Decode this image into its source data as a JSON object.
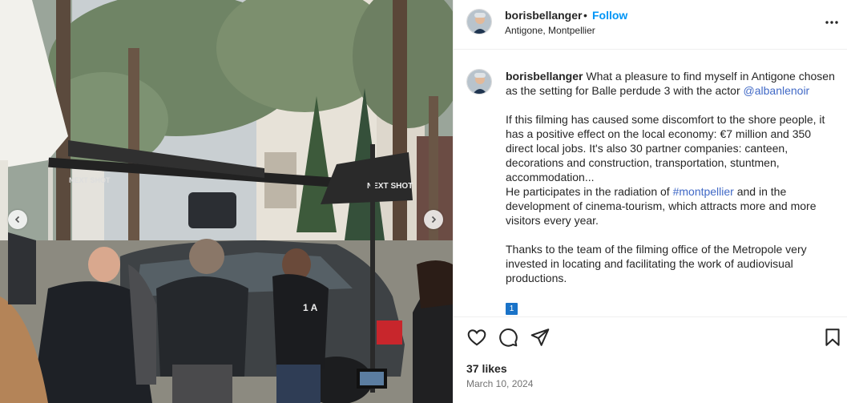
{
  "post": {
    "username": "borisbellanger",
    "separator": "•",
    "follow_label": "Follow",
    "location": "Antigone, Montpellier"
  },
  "caption": {
    "username": "borisbellanger",
    "intro": "What a pleasure to find myself in Antigone chosen as the setting for Balle perdude 3 with the actor",
    "mention": "@albanlenoir",
    "para2": "If this filming has caused some discomfort to the shore people, it has a positive effect on the local economy: €7 million and 350 direct local jobs. It's also 30 partner companies: canteen, decorations and construction, transportation, stuntmen, accommodation...",
    "para3_before": "He participates in the radiation of",
    "hashtag": "#montpellier",
    "para3_after": "and in the development of cinema-tourism, which attracts more and more visitors every year.",
    "para4": "Thanks to the team of the filming office of the Metropole very invested in locating and facilitating the work of audiovisual productions.",
    "emoji": "1"
  },
  "photo": {
    "crane_label": "NEXT SHOT",
    "crane_label_left": "NEXT SHOT",
    "jacket_text": "1 A"
  },
  "footer": {
    "likes": "37 likes",
    "date": "March 10, 2024"
  },
  "colors": {
    "follow": "#0095f6",
    "link": "#4169c6",
    "text": "#262626",
    "muted": "#737373",
    "border": "#efefef"
  },
  "icons": {
    "like": "heart-icon",
    "comment": "comment-icon",
    "share": "paper-plane-icon",
    "save": "bookmark-icon",
    "more": "more-horizontal-icon",
    "prev": "chevron-left-icon",
    "next": "chevron-right-icon"
  }
}
